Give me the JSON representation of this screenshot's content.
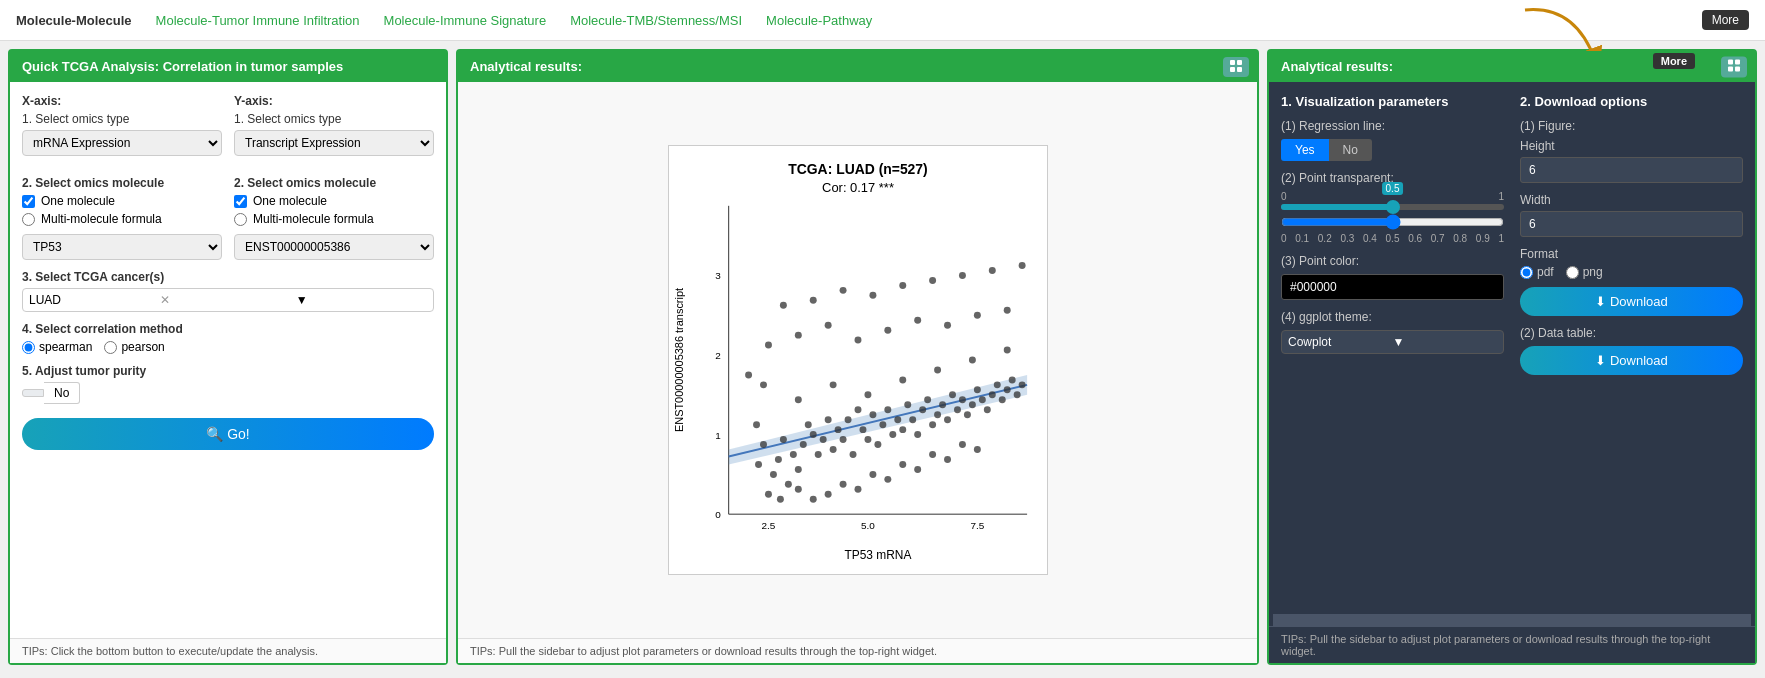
{
  "nav": {
    "items": [
      {
        "label": "Molecule-Molecule",
        "active": true
      },
      {
        "label": "Molecule-Tumor Immune Infiltration",
        "active": false
      },
      {
        "label": "Molecule-Immune Signature",
        "active": false
      },
      {
        "label": "Molecule-TMB/Stemness/MSI",
        "active": false
      },
      {
        "label": "Molecule-Pathway",
        "active": false
      }
    ],
    "more_label": "More"
  },
  "left_panel": {
    "header": "Quick TCGA Analysis: Correlation in tumor samples",
    "xaxis_label": "X-axis:",
    "yaxis_label": "Y-axis:",
    "step1_label": "1. Select omics type",
    "step1_x_value": "mRNA Expression",
    "step1_y_value": "Transcript Expression",
    "step2_label": "2. Select omics molecule",
    "one_molecule": "One molecule",
    "multi_formula": "Multi-molecule formula",
    "x_molecule_value": "TP53",
    "y_molecule_value": "ENST00000005386",
    "step3_label": "3. Select TCGA cancer(s)",
    "tcga_value": "LUAD",
    "step4_label": "4. Select correlation method",
    "spearman_label": "spearman",
    "pearson_label": "pearson",
    "step5_label": "5. Adjust tumor purity",
    "toggle_no": "No",
    "go_label": "🔍 Go!",
    "tips": "TIPs: Click the bottom button to execute/update the analysis."
  },
  "mid_panel": {
    "header": "Analytical results:",
    "chart_title": "TCGA: LUAD (n=527)",
    "chart_subtitle": "Cor: 0.17 ***",
    "x_axis_label": "TP53 mRNA",
    "y_axis_label": "ENST00000005386 transcript",
    "tips": "TIPs: Pull the sidebar to adjust plot parameters or download results through the top-right widget."
  },
  "right_panel": {
    "header": "Analytical results:",
    "section1_title": "1. Visualization parameters",
    "section2_title": "2. Download options",
    "reg_line_label": "(1) Regression line:",
    "yes_label": "Yes",
    "no_label": "No",
    "point_transparent_label": "(2) Point transparent:",
    "slider_min": "0",
    "slider_max": "1",
    "slider_value": "0.5",
    "slider_ticks": [
      "0",
      "0.1",
      "0.2",
      "0.3",
      "0.4",
      "0.5",
      "0.6",
      "0.7",
      "0.8",
      "0.9",
      "1"
    ],
    "point_color_label": "(3) Point color:",
    "point_color_value": "#000000",
    "ggplot_theme_label": "(4) ggplot theme:",
    "ggplot_theme_value": "Cowplot",
    "figure_label": "(1) Figure:",
    "height_label": "Height",
    "height_value": "6",
    "width_label": "Width",
    "width_value": "6",
    "format_label": "Format",
    "pdf_label": "pdf",
    "png_label": "png",
    "download_label": "⬇ Download",
    "datatable_label": "(2) Data table:",
    "download2_label": "⬇ Download",
    "tips": "TIPs: Pull the sidebar to adjust plot parameters or download results through the top-right widget.",
    "more_label": "More"
  }
}
